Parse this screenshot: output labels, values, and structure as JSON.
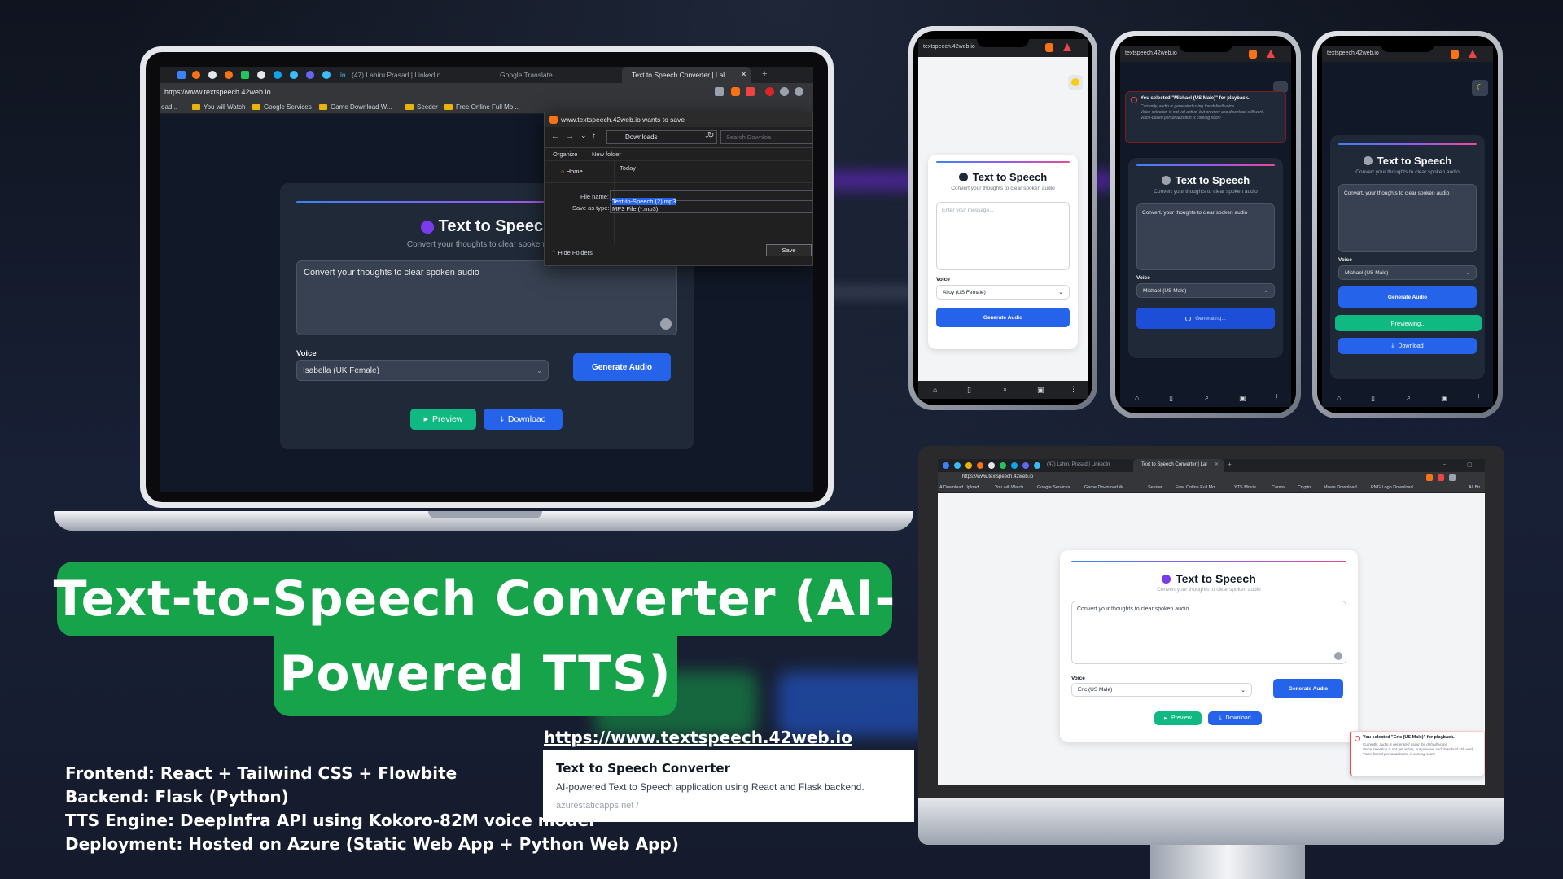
{
  "title": {
    "line1": "Text-to-Speech Converter (AI-",
    "line2": "Powered TTS)"
  },
  "tech_stack": [
    "Frontend: React + Tailwind CSS + Flowbite",
    "Backend: Flask (Python)",
    "TTS Engine: DeepInfra API using Kokoro-82M voice model",
    "Deployment: Hosted on Azure (Static Web App + Python Web App)"
  ],
  "link_preview": {
    "url": "https://www.textspeech.42web.io",
    "title": "Text to Speech Converter",
    "description": "AI-powered Text to Speech application using React and Flask backend.",
    "domain": "azurestaticapps.net"
  },
  "laptop": {
    "tabs": [
      "(47) Lahiru Prasad | LinkedIn",
      "Google Translate",
      "Text to Speech Converter | Lal"
    ],
    "address": "https://www.textspeech.42web.io",
    "bookmarks": [
      "oad...",
      "You will Watch",
      "Google Services",
      "Game Download W...",
      "Seeder",
      "Free Online Full Mo..."
    ],
    "app": {
      "title": "Text to Speech",
      "subtitle": "Convert your thoughts to clear spoken audio",
      "textarea": "Convert your thoughts to clear spoken audio",
      "voice_label": "Voice",
      "voice_value": "Isabella (UK Female)",
      "generate": "Generate Audio",
      "preview": "Preview",
      "download": "Download"
    },
    "save_dialog": {
      "title": "www.textspeech.42web.io wants to save",
      "location": "Downloads",
      "search": "Search Downloa",
      "organize": "Organize",
      "new_folder": "New folder",
      "home": "Home",
      "today": "Today",
      "file_name_label": "File name:",
      "file_name": "Text-to-Speech (2).mp3",
      "save_type_label": "Save as type:",
      "save_type": "MP3 File (*.mp3)",
      "hide_folders": "Hide Folders",
      "save": "Save"
    }
  },
  "phones": [
    {
      "url": "textspeech.42web.io",
      "title": "Text to Speech",
      "subtitle": "Convert your thoughts to clear spoken audio",
      "placeholder": "Enter your message...",
      "voice_label": "Voice",
      "voice_value": "Alloy (US Female)",
      "generate": "Generate Audio"
    },
    {
      "url": "textspeech.42web.io",
      "toast_title": "You selected \"Michael (US Male)\" for playback.",
      "toast_lines": [
        "Currently, audio is generated using the default voice.",
        "Voice selection is not yet active, but preview and download still work.",
        "Voice-based personalization is coming soon!"
      ],
      "title": "Text to Speech",
      "subtitle": "Convert your thoughts to clear spoken audio",
      "textarea": "Convert. your thoughts to clear spoken audio",
      "voice_label": "Voice",
      "voice_value": "Michael (US Male)",
      "generating": "Generating..."
    },
    {
      "url": "textspeech.42web.io",
      "title": "Text to Speech",
      "subtitle": "Convert your thoughts to clear spoken audio",
      "textarea": "Convert. your thoughts to clear spoken audio",
      "voice_label": "Voice",
      "voice_value": "Michael (US Male)",
      "generate": "Generate Audio",
      "previewing": "Previewing...",
      "download": "Download"
    }
  ],
  "monitor": {
    "tabs": [
      "(47) Lahiru Prasad | LinkedIn",
      "Text to Speech Converter | Lal"
    ],
    "address": "https://www.textspeech.42web.io",
    "bookmarks": [
      "A Download Upload...",
      "You will Watch",
      "Google Services",
      "Game Download W...",
      "Seeder",
      "Free Online Full Mo...",
      "YTS Movie",
      "Canva",
      "Crypto",
      "Movie Download",
      "PNG Logo Download",
      "All Bo"
    ],
    "app": {
      "title": "Text to Speech",
      "subtitle": "Convert your thoughts to clear spoken audio",
      "textarea": "Convert your thoughts to clear spoken audio",
      "voice_label": "Voice",
      "voice_value": "Eric (US Male)",
      "generate": "Generate Audio",
      "preview": "Preview",
      "download": "Download"
    },
    "toast_title": "You selected \"Eric (US Male)\" for playback.",
    "toast_lines": [
      "Currently, audio is generated using the default voice.",
      "Voice selection is not yet active, but preview and download still work.",
      "Voice-based personalization is coming soon!"
    ]
  },
  "colors": {
    "accent_green": "#16a34a",
    "button_blue": "#2563eb",
    "preview_green": "#10b981",
    "background": "#151b2c"
  }
}
